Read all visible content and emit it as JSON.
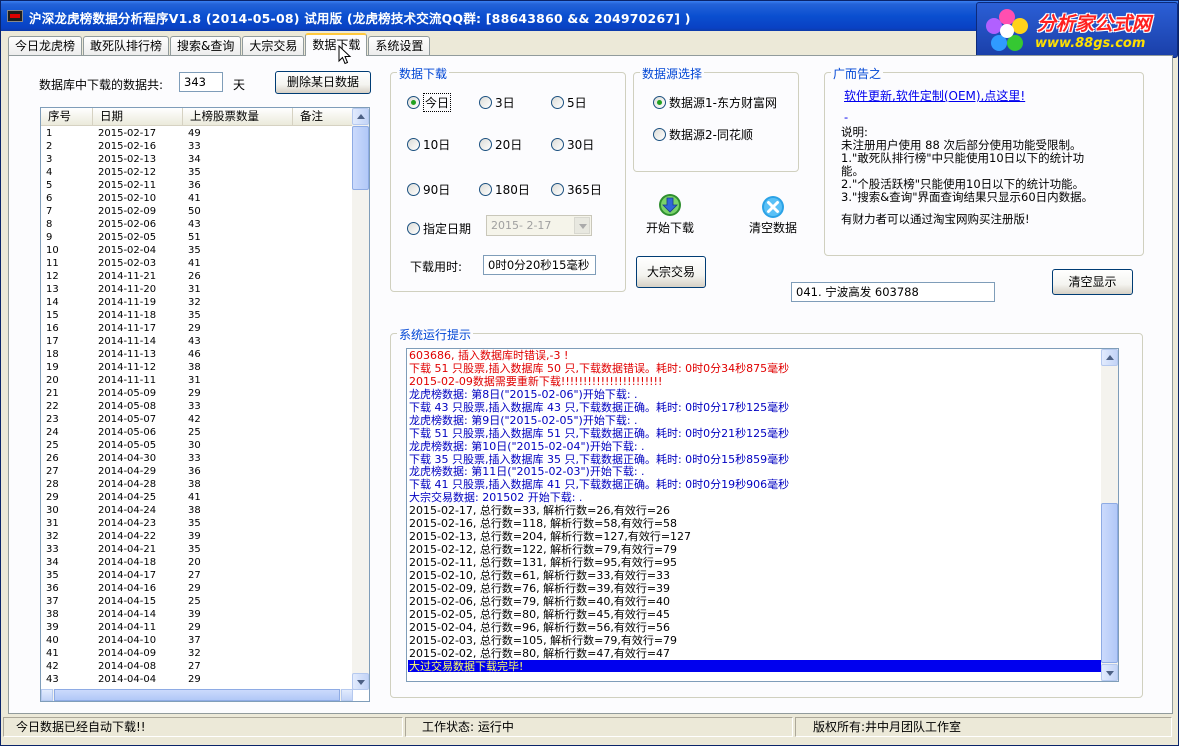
{
  "window": {
    "title": "沪深龙虎榜数据分析程序V1.8 (2014-05-08)  试用版 (龙虎榜技术交流QQ群: [88643860 && 204970267]  )",
    "logo_name": "分析家公式网",
    "logo_url": "www.88gs.com"
  },
  "tabs": [
    {
      "label": "今日龙虎榜"
    },
    {
      "label": "敢死队排行榜"
    },
    {
      "label": "搜索&查询"
    },
    {
      "label": "大宗交易"
    },
    {
      "label": "数据下载",
      "active": true
    },
    {
      "label": "系统设置"
    }
  ],
  "left": {
    "count_label": "数据库中下载的数据共:",
    "count_value": "343",
    "count_unit": "天",
    "delete_button": "删除某日数据",
    "table": {
      "headers": [
        "序号",
        "日期",
        "上榜股票数量",
        "备注"
      ],
      "rows": [
        [
          "1",
          "2015-02-17",
          "49",
          ""
        ],
        [
          "2",
          "2015-02-16",
          "33",
          ""
        ],
        [
          "3",
          "2015-02-13",
          "34",
          ""
        ],
        [
          "4",
          "2015-02-12",
          "35",
          ""
        ],
        [
          "5",
          "2015-02-11",
          "36",
          ""
        ],
        [
          "6",
          "2015-02-10",
          "41",
          ""
        ],
        [
          "7",
          "2015-02-09",
          "50",
          ""
        ],
        [
          "8",
          "2015-02-06",
          "43",
          ""
        ],
        [
          "9",
          "2015-02-05",
          "51",
          ""
        ],
        [
          "10",
          "2015-02-04",
          "35",
          ""
        ],
        [
          "11",
          "2015-02-03",
          "41",
          ""
        ],
        [
          "12",
          "2014-11-21",
          "26",
          ""
        ],
        [
          "13",
          "2014-11-20",
          "31",
          ""
        ],
        [
          "14",
          "2014-11-19",
          "32",
          ""
        ],
        [
          "15",
          "2014-11-18",
          "35",
          ""
        ],
        [
          "16",
          "2014-11-17",
          "29",
          ""
        ],
        [
          "17",
          "2014-11-14",
          "43",
          ""
        ],
        [
          "18",
          "2014-11-13",
          "46",
          ""
        ],
        [
          "19",
          "2014-11-12",
          "38",
          ""
        ],
        [
          "20",
          "2014-11-11",
          "31",
          ""
        ],
        [
          "21",
          "2014-05-09",
          "29",
          ""
        ],
        [
          "22",
          "2014-05-08",
          "33",
          ""
        ],
        [
          "23",
          "2014-05-07",
          "42",
          ""
        ],
        [
          "24",
          "2014-05-06",
          "25",
          ""
        ],
        [
          "25",
          "2014-05-05",
          "30",
          ""
        ],
        [
          "26",
          "2014-04-30",
          "33",
          ""
        ],
        [
          "27",
          "2014-04-29",
          "36",
          ""
        ],
        [
          "28",
          "2014-04-28",
          "38",
          ""
        ],
        [
          "29",
          "2014-04-25",
          "41",
          ""
        ],
        [
          "30",
          "2014-04-24",
          "38",
          ""
        ],
        [
          "31",
          "2014-04-23",
          "35",
          ""
        ],
        [
          "32",
          "2014-04-22",
          "39",
          ""
        ],
        [
          "33",
          "2014-04-21",
          "35",
          ""
        ],
        [
          "34",
          "2014-04-18",
          "20",
          ""
        ],
        [
          "35",
          "2014-04-17",
          "27",
          ""
        ],
        [
          "36",
          "2014-04-16",
          "29",
          ""
        ],
        [
          "37",
          "2014-04-15",
          "25",
          ""
        ],
        [
          "38",
          "2014-04-14",
          "39",
          ""
        ],
        [
          "39",
          "2014-04-11",
          "29",
          ""
        ],
        [
          "40",
          "2014-04-10",
          "37",
          ""
        ],
        [
          "41",
          "2014-04-09",
          "32",
          ""
        ],
        [
          "42",
          "2014-04-08",
          "27",
          ""
        ],
        [
          "43",
          "2014-04-04",
          "29",
          ""
        ]
      ]
    }
  },
  "download": {
    "group_title": "数据下载",
    "radios": [
      "今日",
      "3日",
      "5日",
      "10日",
      "20日",
      "30日",
      "90日",
      "180日",
      "365日"
    ],
    "specified_date_label": "指定日期",
    "specified_date_value": "2015- 2-17",
    "elapsed_label": "下载用时:",
    "elapsed_value": "0时0分20秒15毫秒",
    "bulk_button": "大宗交易"
  },
  "source": {
    "group_title": "数据源选择",
    "options": [
      "数据源1-东方财富网",
      "数据源2-同花顺"
    ],
    "start_label": "开始下载",
    "clear_label": "清空数据",
    "stock_field": "041.  宁波高发   603788"
  },
  "ad": {
    "group_title": "广而告之",
    "link": "软件更新,软件定制(OEM),点这里!",
    "dash": "-",
    "lines": [
      "说明:",
      "    未注册用户使用 88 次后部分使用功能受限制。",
      "  1.\"敢死队排行榜\"中只能使用10日以下的统计功",
      "能。",
      "  2.\"个股活跃榜\"只能使用10日以下的统计功能。",
      "  3.\"搜索&查询\"界面查询结果只显示60日内数据。",
      "",
      "    有财力者可以通过淘宝网购买注册版!"
    ],
    "clear_display_button": "清空显示"
  },
  "log": {
    "group_title": "系统运行提示",
    "lines": [
      {
        "text": "603686, 插入数据库时错误,-3 !",
        "color": "red"
      },
      {
        "text": "下载 51 只股票,插入数据库 50 只,下载数据错误。耗时: 0时0分34秒875毫秒",
        "color": "red"
      },
      {
        "text": "2015-02-09数据需要重新下载!!!!!!!!!!!!!!!!!!!!!!!",
        "color": "red"
      },
      {
        "text": "龙虎榜数据: 第8日(\"2015-02-06\")开始下载: .",
        "color": "blue"
      },
      {
        "text": "下载 43 只股票,插入数据库 43 只,下载数据正确。耗时: 0时0分17秒125毫秒",
        "color": "blue"
      },
      {
        "text": "龙虎榜数据: 第9日(\"2015-02-05\")开始下载: .",
        "color": "blue"
      },
      {
        "text": "下载 51 只股票,插入数据库 51 只,下载数据正确。耗时: 0时0分21秒125毫秒",
        "color": "blue"
      },
      {
        "text": "龙虎榜数据: 第10日(\"2015-02-04\")开始下载: .",
        "color": "blue"
      },
      {
        "text": "下载 35 只股票,插入数据库 35 只,下载数据正确。耗时: 0时0分15秒859毫秒",
        "color": "blue"
      },
      {
        "text": "龙虎榜数据: 第11日(\"2015-02-03\")开始下载: .",
        "color": "blue"
      },
      {
        "text": "下载 41 只股票,插入数据库 41 只,下载数据正确。耗时: 0时0分19秒906毫秒",
        "color": "blue"
      },
      {
        "text": "大宗交易数据:  201502 开始下载: .",
        "color": "blue"
      },
      {
        "text": "2015-02-17,  总行数=33,  解析行数=26,有效行=26",
        "color": "black"
      },
      {
        "text": "2015-02-16,  总行数=118,  解析行数=58,有效行=58",
        "color": "black"
      },
      {
        "text": "2015-02-13,  总行数=204,  解析行数=127,有效行=127",
        "color": "black"
      },
      {
        "text": "2015-02-12,  总行数=122,  解析行数=79,有效行=79",
        "color": "black"
      },
      {
        "text": "2015-02-11,  总行数=131,  解析行数=95,有效行=95",
        "color": "black"
      },
      {
        "text": "2015-02-10,  总行数=61,  解析行数=33,有效行=33",
        "color": "black"
      },
      {
        "text": "2015-02-09,  总行数=76,  解析行数=39,有效行=39",
        "color": "black"
      },
      {
        "text": "2015-02-06,  总行数=79,  解析行数=40,有效行=40",
        "color": "black"
      },
      {
        "text": "2015-02-05,  总行数=80,  解析行数=45,有效行=45",
        "color": "black"
      },
      {
        "text": "2015-02-04,  总行数=96,  解析行数=56,有效行=56",
        "color": "black"
      },
      {
        "text": "2015-02-03,  总行数=105,  解析行数=79,有效行=79",
        "color": "black"
      },
      {
        "text": "2015-02-02,  总行数=80,  解析行数=47,有效行=47",
        "color": "black"
      },
      {
        "text": "大过交易数据下载完毕!",
        "color": "selected"
      }
    ]
  },
  "status": {
    "left": "今日数据已经自动下载!!",
    "middle": "工作状态: 运行中",
    "right": "版权所有:井中月团队工作室"
  }
}
